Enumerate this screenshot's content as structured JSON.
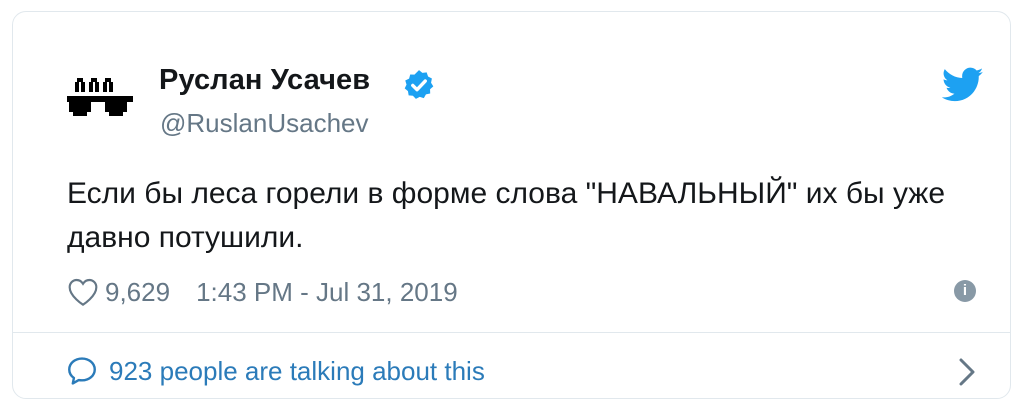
{
  "author": {
    "display_name": "Руслан Усачев",
    "handle": "@RuslanUsachev",
    "avatar_icon": "pixel-sunglasses-face-icon",
    "verified_icon": "verified-badge-icon"
  },
  "tweet": {
    "text": "Если бы леса горели в форме слова \"НАВАЛЬНЫЙ\" их бы уже давно потушили.",
    "likes": "9,629",
    "timestamp": "1:43 PM - Jul 31, 2019"
  },
  "conversation": {
    "label": "923 people are talking about this"
  },
  "icons": {
    "brand": "twitter-bird-icon",
    "like": "heart-icon",
    "info": "info-icon",
    "reply": "speech-bubble-icon",
    "chevron": "chevron-right-icon"
  },
  "colors": {
    "brand_blue": "#1da1f2",
    "link_blue": "#2b7bb9",
    "muted_gray": "#657786",
    "text": "#14171a",
    "border": "#e1e8ed"
  }
}
